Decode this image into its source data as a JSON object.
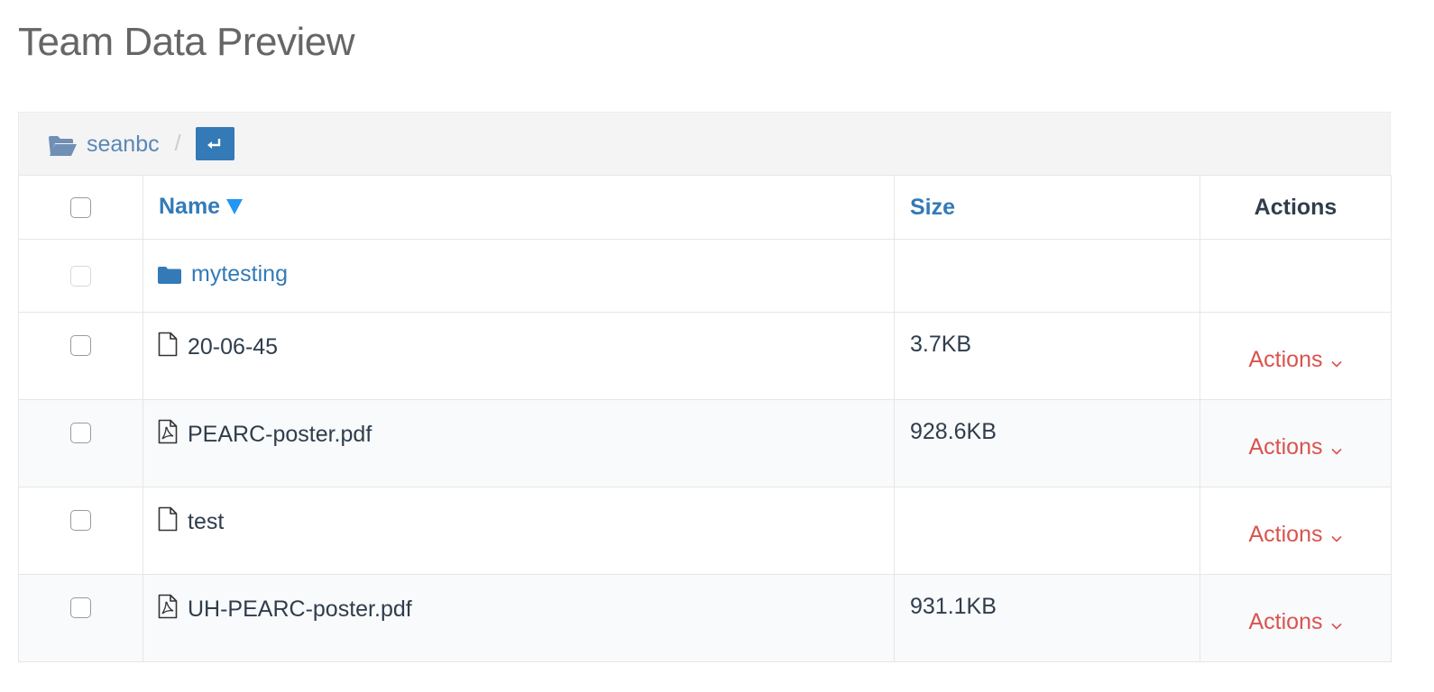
{
  "page": {
    "title": "Team Data Preview"
  },
  "breadcrumb": {
    "folder_icon": "folder-open-icon",
    "current": "seanbc",
    "separator": "/",
    "return_icon": "return-arrow-icon"
  },
  "table": {
    "columns": {
      "name": "Name",
      "size": "Size",
      "actions": "Actions"
    },
    "sort": {
      "column": "Name",
      "direction": "descending",
      "icon": "sort-down-triangle-icon"
    },
    "rows": [
      {
        "type": "folder",
        "icon": "folder-icon",
        "name": "mytesting",
        "size": "",
        "actions": ""
      },
      {
        "type": "file",
        "icon": "file-icon",
        "name": "20-06-45",
        "size": "3.7KB",
        "actions": "Actions"
      },
      {
        "type": "pdf",
        "icon": "pdf-file-icon",
        "name": "PEARC-poster.pdf",
        "size": "928.6KB",
        "actions": "Actions"
      },
      {
        "type": "file",
        "icon": "file-icon",
        "name": "test",
        "size": "",
        "actions": "Actions"
      },
      {
        "type": "pdf",
        "icon": "pdf-file-icon",
        "name": "UH-PEARC-poster.pdf",
        "size": "931.1KB",
        "actions": "Actions"
      }
    ]
  },
  "colors": {
    "link": "#337ab7",
    "breadcrumb_link": "#5b87b7",
    "actions": "#d9534f",
    "sort_icon": "#2196f3",
    "title": "#666666"
  }
}
